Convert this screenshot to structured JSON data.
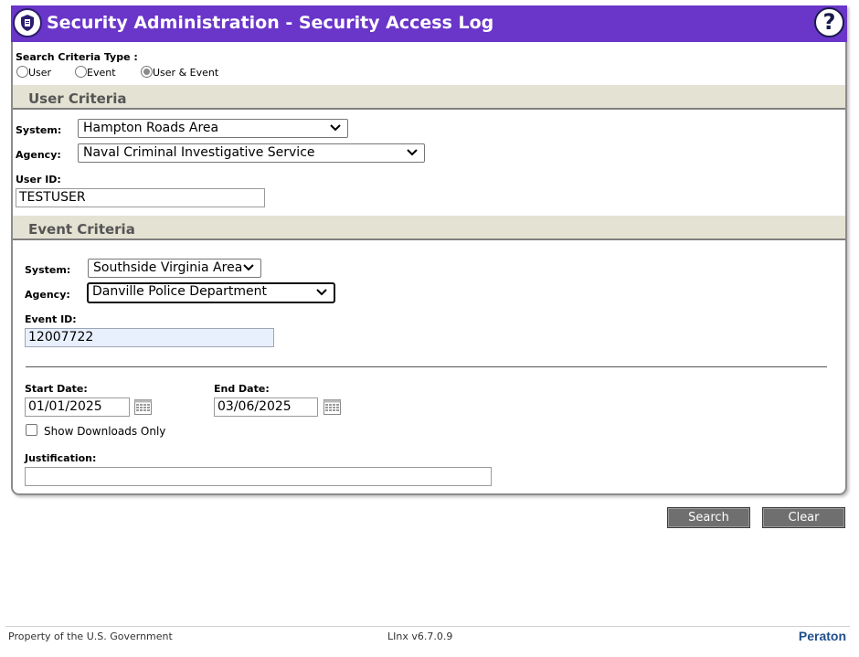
{
  "header": {
    "title": "Security Administration - Security Access Log",
    "app_icon": "shield-document-icon",
    "help_icon": "help-question-icon",
    "title_bar_color": "#6a35c9"
  },
  "search_type": {
    "label": "Search Criteria Type :",
    "options": [
      "User",
      "Event",
      "User & Event"
    ],
    "selected": "User & Event"
  },
  "user_criteria": {
    "heading": "User Criteria",
    "system_label": "System:",
    "system_value": "Hampton Roads Area",
    "agency_label": "Agency:",
    "agency_value": "Naval Criminal Investigative Service",
    "userid_label": "User ID:",
    "userid_value": "TESTUSER"
  },
  "event_criteria": {
    "heading": "Event Criteria",
    "system_label": "System:",
    "system_value": "Southside Virginia Area",
    "agency_label": "Agency:",
    "agency_value": "Danville Police Department",
    "eventid_label": "Event ID:",
    "eventid_value": "12007722"
  },
  "dates": {
    "start_label": "Start Date:",
    "start_value": "01/01/2025",
    "end_label": "End Date:",
    "end_value": "03/06/2025",
    "calendar_icon": "calendar-icon"
  },
  "downloads": {
    "label": "Show Downloads Only",
    "checked": false
  },
  "justification": {
    "label": "Justification:",
    "value": ""
  },
  "actions": {
    "search_label": "Search",
    "clear_label": "Clear"
  },
  "footer": {
    "left": "Property of the U.S. Government",
    "center": "LInx v6.7.0.9",
    "brand": "Peraton"
  }
}
